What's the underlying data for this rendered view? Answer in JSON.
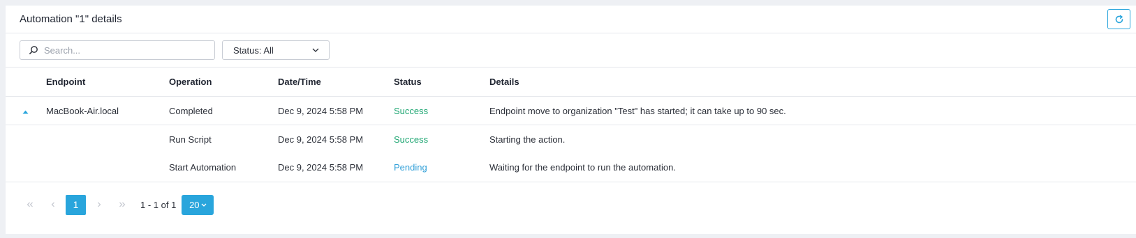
{
  "header": {
    "title": "Automation \"1\" details"
  },
  "toolbar": {
    "search_placeholder": "Search...",
    "status_filter": "Status: All"
  },
  "table": {
    "columns": [
      "Endpoint",
      "Operation",
      "Date/Time",
      "Status",
      "Details"
    ],
    "group": {
      "endpoint": "MacBook-Air.local",
      "rows": [
        {
          "operation": "Completed",
          "datetime": "Dec 9, 2024 5:58 PM",
          "status": "Success",
          "details": "Endpoint move to organization \"Test\" has started; it can take up to 90 sec."
        },
        {
          "operation": "Run Script",
          "datetime": "Dec 9, 2024 5:58 PM",
          "status": "Success",
          "details": "Starting the action."
        },
        {
          "operation": "Start Automation",
          "datetime": "Dec 9, 2024 5:58 PM",
          "status": "Pending",
          "details": "Waiting for the endpoint to run the automation."
        }
      ]
    }
  },
  "pagination": {
    "current_page": "1",
    "range": "1 - 1 of 1",
    "page_size": "20"
  },
  "colors": {
    "accent": "#29a5dc",
    "success": "#1ea672",
    "pending": "#2f9fd8"
  }
}
